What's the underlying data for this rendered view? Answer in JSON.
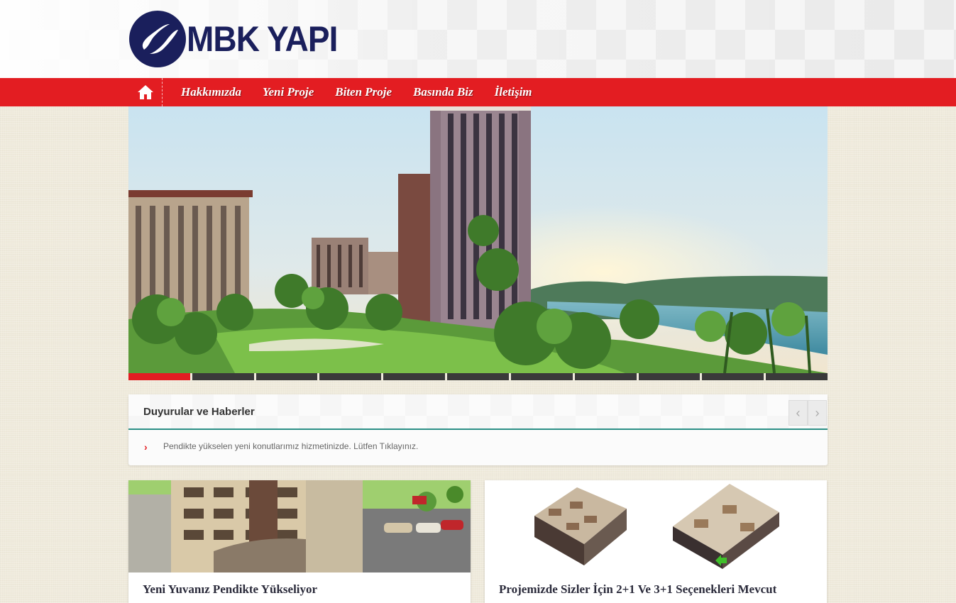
{
  "brand": {
    "name": "MBK YAPI",
    "primary_color": "#e31d22",
    "logo_color": "#1a1f5c"
  },
  "nav": {
    "home_icon": "home-icon",
    "items": [
      {
        "label": "Hakkımızda"
      },
      {
        "label": "Yeni Proje"
      },
      {
        "label": "Biten Proje"
      },
      {
        "label": "Basında Biz"
      },
      {
        "label": "İletişim"
      }
    ]
  },
  "slider": {
    "slide_count": 11,
    "active_index": 0
  },
  "news": {
    "title": "Duyurular ve Haberler",
    "prev_icon": "chevron-left-icon",
    "next_icon": "chevron-right-icon",
    "item_text": "Pendikte yükselen yeni konutlarımız hizmetinizde. Lütfen Tıklayınız."
  },
  "cards": [
    {
      "title": "Yeni Yuvanız Pendikte Yükseliyor"
    },
    {
      "title": "Projemizde Sizler İçin 2+1 Ve 3+1 Seçenekleri Mevcut"
    }
  ]
}
